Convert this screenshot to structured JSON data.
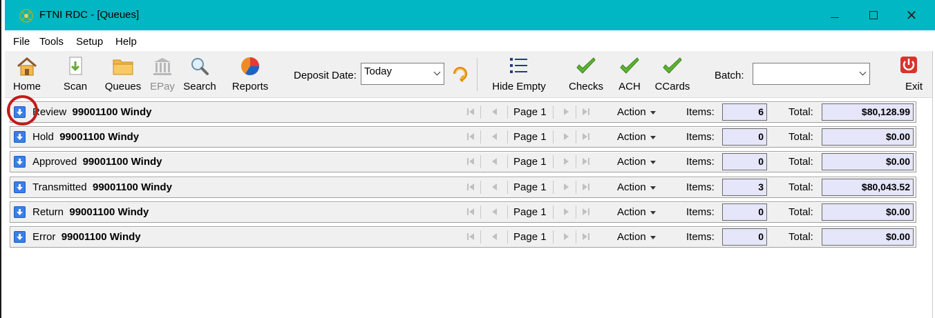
{
  "window": {
    "title": "FTNI RDC - [Queues]"
  },
  "window_controls": {
    "minimize": "",
    "maximize": "",
    "close": "✕"
  },
  "menu": [
    "File",
    "Tools",
    "Setup",
    "Help"
  ],
  "toolbar": {
    "buttons": [
      {
        "label": "Home",
        "icon": "home-icon",
        "enabled": true
      },
      {
        "label": "Scan",
        "icon": "scan-icon",
        "enabled": true
      },
      {
        "label": "Queues",
        "icon": "folder-icon",
        "enabled": true
      },
      {
        "label": "EPay",
        "icon": "bank-icon",
        "enabled": false
      },
      {
        "label": "Search",
        "icon": "magnifier-icon",
        "enabled": true
      },
      {
        "label": "Reports",
        "icon": "pie-chart-icon",
        "enabled": true
      }
    ],
    "deposit_date_label": "Deposit Date:",
    "deposit_date_value": "Today",
    "hide_empty_label": "Hide Empty",
    "filters": [
      {
        "label": "Checks",
        "icon": "checkmark-icon"
      },
      {
        "label": "ACH",
        "icon": "checkmark-icon"
      },
      {
        "label": "CCards",
        "icon": "checkmark-icon"
      }
    ],
    "batch_label": "Batch:",
    "batch_value": "",
    "exit_label": "Exit"
  },
  "queues": [
    {
      "name": "Review",
      "account": "99001100 Windy",
      "page": "Page 1",
      "action": "Action",
      "items_label": "Items:",
      "items": "6",
      "total_label": "Total:",
      "total": "$80,128.99"
    },
    {
      "name": "Hold",
      "account": "99001100 Windy",
      "page": "Page 1",
      "action": "Action",
      "items_label": "Items:",
      "items": "0",
      "total_label": "Total:",
      "total": "$0.00"
    },
    {
      "name": "Approved",
      "account": "99001100 Windy",
      "page": "Page 1",
      "action": "Action",
      "items_label": "Items:",
      "items": "0",
      "total_label": "Total:",
      "total": "$0.00"
    },
    {
      "name": "Transmitted",
      "account": "99001100 Windy",
      "page": "Page 1",
      "action": "Action",
      "items_label": "Items:",
      "items": "3",
      "total_label": "Total:",
      "total": "$80,043.52"
    },
    {
      "name": "Return",
      "account": "99001100 Windy",
      "page": "Page 1",
      "action": "Action",
      "items_label": "Items:",
      "items": "0",
      "total_label": "Total:",
      "total": "$0.00"
    },
    {
      "name": "Error",
      "account": "99001100 Windy",
      "page": "Page 1",
      "action": "Action",
      "items_label": "Items:",
      "items": "0",
      "total_label": "Total:",
      "total": "$0.00"
    }
  ],
  "colors": {
    "titlebar": "#00b7c3",
    "value_box": "#e6e6fa",
    "check_green": "#5cb531",
    "highlight": "#c41b1b",
    "expand_button": "#3b7fe6"
  }
}
